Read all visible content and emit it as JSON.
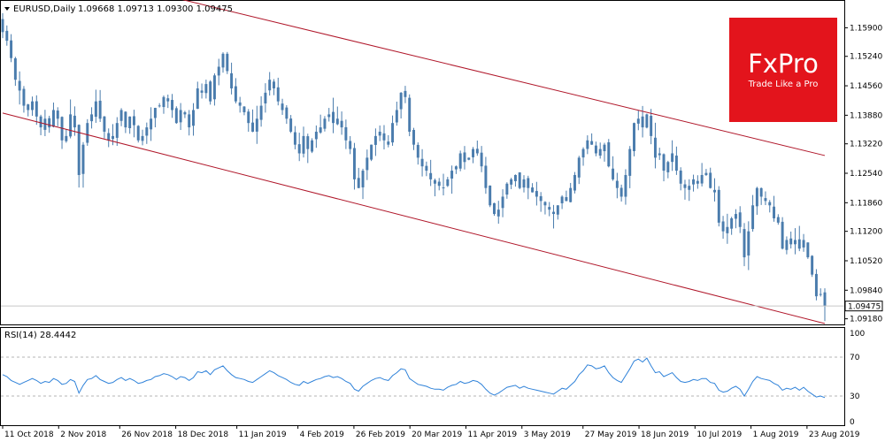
{
  "header": {
    "symbol": "EURUSD,Daily",
    "ohlc": "1.09668 1.09713 1.09300 1.09475"
  },
  "logo": {
    "brand": "FxPro",
    "tagline": "Trade Like a Pro",
    "color": "#e3141c"
  },
  "rsi": {
    "label": "RSI(14) 28.4442",
    "levels": [
      {
        "value": 100,
        "label": "100"
      },
      {
        "value": 70,
        "label": "70"
      },
      {
        "value": 30,
        "label": "30"
      },
      {
        "value": 0,
        "label": "0"
      }
    ]
  },
  "colors": {
    "candle": "#4a7cad",
    "channel": "#b0172a",
    "rsi_line": "#2f82d9",
    "current_price_line": "#c8c8c8",
    "level_line": "#b4b4b4"
  },
  "chart_data": {
    "type": "candlestick",
    "symbol": "EURUSD",
    "timeframe": "Daily",
    "x_range": [
      "2018-10-11",
      "2019-08-30"
    ],
    "y_ticks": [
      {
        "value": 1.159,
        "label": "1.15900"
      },
      {
        "value": 1.1524,
        "label": "1.15240"
      },
      {
        "value": 1.1456,
        "label": "1.14560"
      },
      {
        "value": 1.1388,
        "label": "1.13880"
      },
      {
        "value": 1.1322,
        "label": "1.13220"
      },
      {
        "value": 1.1254,
        "label": "1.12540"
      },
      {
        "value": 1.1186,
        "label": "1.11860"
      },
      {
        "value": 1.112,
        "label": "1.11200"
      },
      {
        "value": 1.1052,
        "label": "1.10520"
      },
      {
        "value": 1.0984,
        "label": "1.09840"
      },
      {
        "value": 1.0918,
        "label": "1.09180"
      }
    ],
    "ylim": [
      1.0905,
      1.165
    ],
    "current_price": {
      "value": 1.09475,
      "label": "1.09475"
    },
    "x_ticks": [
      {
        "date": "2018-10-11",
        "label": "11 Oct 2018"
      },
      {
        "date": "2018-11-02",
        "label": "2 Nov 2018"
      },
      {
        "date": "2018-11-26",
        "label": "26 Nov 2018"
      },
      {
        "date": "2018-12-18",
        "label": "18 Dec 2018"
      },
      {
        "date": "2019-01-11",
        "label": "11 Jan 2019"
      },
      {
        "date": "2019-02-04",
        "label": "4 Feb 2019"
      },
      {
        "date": "2019-02-26",
        "label": "26 Feb 2019"
      },
      {
        "date": "2019-03-20",
        "label": "20 Mar 2019"
      },
      {
        "date": "2019-04-11",
        "label": "11 Apr 2019"
      },
      {
        "date": "2019-05-03",
        "label": "3 May 2019"
      },
      {
        "date": "2019-05-27",
        "label": "27 May 2019"
      },
      {
        "date": "2019-06-18",
        "label": "18 Jun 2019"
      },
      {
        "date": "2019-07-10",
        "label": "10 Jul 2019"
      },
      {
        "date": "2019-08-01",
        "label": "1 Aug 2019"
      },
      {
        "date": "2019-08-23",
        "label": "23 Aug 2019"
      }
    ],
    "closes": [
      1.158,
      1.156,
      1.152,
      1.147,
      1.1445,
      1.141,
      1.14,
      1.142,
      1.1385,
      1.136,
      1.138,
      1.136,
      1.14,
      1.138,
      1.133,
      1.134,
      1.139,
      1.136,
      1.125,
      1.132,
      1.137,
      1.139,
      1.142,
      1.138,
      1.135,
      1.133,
      1.134,
      1.137,
      1.14,
      1.136,
      1.1385,
      1.1365,
      1.133,
      1.134,
      1.136,
      1.138,
      1.1405,
      1.141,
      1.143,
      1.142,
      1.14,
      1.137,
      1.14,
      1.139,
      1.136,
      1.14,
      1.145,
      1.144,
      1.146,
      1.142,
      1.148,
      1.15,
      1.153,
      1.149,
      1.145,
      1.142,
      1.141,
      1.1395,
      1.137,
      1.135,
      1.138,
      1.141,
      1.144,
      1.147,
      1.145,
      1.142,
      1.14,
      1.138,
      1.135,
      1.132,
      1.13,
      1.134,
      1.131,
      1.133,
      1.135,
      1.136,
      1.138,
      1.139,
      1.137,
      1.138,
      1.136,
      1.133,
      1.131,
      1.124,
      1.122,
      1.126,
      1.129,
      1.132,
      1.134,
      1.135,
      1.133,
      1.132,
      1.137,
      1.14,
      1.144,
      1.143,
      1.135,
      1.132,
      1.129,
      1.127,
      1.126,
      1.124,
      1.123,
      1.1225,
      1.122,
      1.124,
      1.126,
      1.127,
      1.13,
      1.128,
      1.129,
      1.131,
      1.13,
      1.127,
      1.122,
      1.118,
      1.116,
      1.117,
      1.12,
      1.123,
      1.124,
      1.125,
      1.122,
      1.124,
      1.122,
      1.121,
      1.12,
      1.119,
      1.118,
      1.117,
      1.116,
      1.118,
      1.12,
      1.119,
      1.122,
      1.125,
      1.129,
      1.131,
      1.133,
      1.132,
      1.13,
      1.131,
      1.132,
      1.127,
      1.124,
      1.122,
      1.12,
      1.125,
      1.131,
      1.137,
      1.138,
      1.136,
      1.139,
      1.134,
      1.129,
      1.13,
      1.126,
      1.128,
      1.13,
      1.126,
      1.123,
      1.122,
      1.1225,
      1.124,
      1.123,
      1.125,
      1.125,
      1.122,
      1.121,
      1.114,
      1.112,
      1.113,
      1.115,
      1.116,
      1.113,
      1.106,
      1.112,
      1.118,
      1.122,
      1.12,
      1.119,
      1.118,
      1.115,
      1.114,
      1.108,
      1.11,
      1.109,
      1.11,
      1.108,
      1.11,
      1.106,
      1.102,
      1.097,
      1.0975,
      1.0947
    ],
    "channel": {
      "upper": [
        {
          "date": "2018-11-12",
          "value": 1.171
        },
        {
          "date": "2019-08-30",
          "value": 1.1295
        }
      ],
      "lower": [
        {
          "date": "2018-10-11",
          "value": 1.1393
        },
        {
          "date": "2019-08-30",
          "value": 1.0907
        }
      ]
    },
    "rsi": {
      "name": "RSI(14)",
      "last": 28.4442,
      "ylim": [
        0,
        100
      ],
      "levels": [
        70,
        30
      ],
      "values": [
        52,
        50,
        46,
        44,
        42,
        44,
        46,
        48,
        46,
        43,
        45,
        44,
        48,
        46,
        42,
        43,
        47,
        45,
        33,
        41,
        47,
        48,
        51,
        47,
        45,
        43,
        44,
        47,
        49,
        46,
        48,
        46,
        43,
        44,
        46,
        47,
        50,
        51,
        53,
        52,
        50,
        47,
        50,
        49,
        46,
        49,
        55,
        54,
        56,
        52,
        57,
        59,
        61,
        56,
        52,
        49,
        48,
        47,
        45,
        44,
        47,
        50,
        53,
        56,
        54,
        51,
        49,
        47,
        44,
        42,
        41,
        45,
        43,
        45,
        47,
        48,
        50,
        51,
        49,
        50,
        48,
        45,
        43,
        37,
        35,
        40,
        43,
        46,
        48,
        49,
        47,
        46,
        51,
        54,
        58,
        57,
        48,
        45,
        42,
        41,
        40,
        38,
        37,
        37,
        36,
        39,
        41,
        42,
        45,
        43,
        44,
        46,
        45,
        42,
        37,
        33,
        31,
        33,
        36,
        39,
        40,
        41,
        38,
        40,
        38,
        37,
        36,
        35,
        34,
        33,
        32,
        35,
        38,
        37,
        41,
        45,
        52,
        56,
        62,
        61,
        58,
        59,
        61,
        54,
        49,
        46,
        44,
        51,
        58,
        66,
        68,
        65,
        69,
        61,
        54,
        55,
        50,
        52,
        54,
        49,
        45,
        44,
        45,
        47,
        46,
        48,
        48,
        44,
        43,
        36,
        34,
        35,
        38,
        40,
        37,
        30,
        37,
        45,
        50,
        48,
        47,
        46,
        43,
        41,
        36,
        38,
        37,
        39,
        36,
        39,
        35,
        32,
        29,
        30,
        28.4
      ]
    }
  }
}
